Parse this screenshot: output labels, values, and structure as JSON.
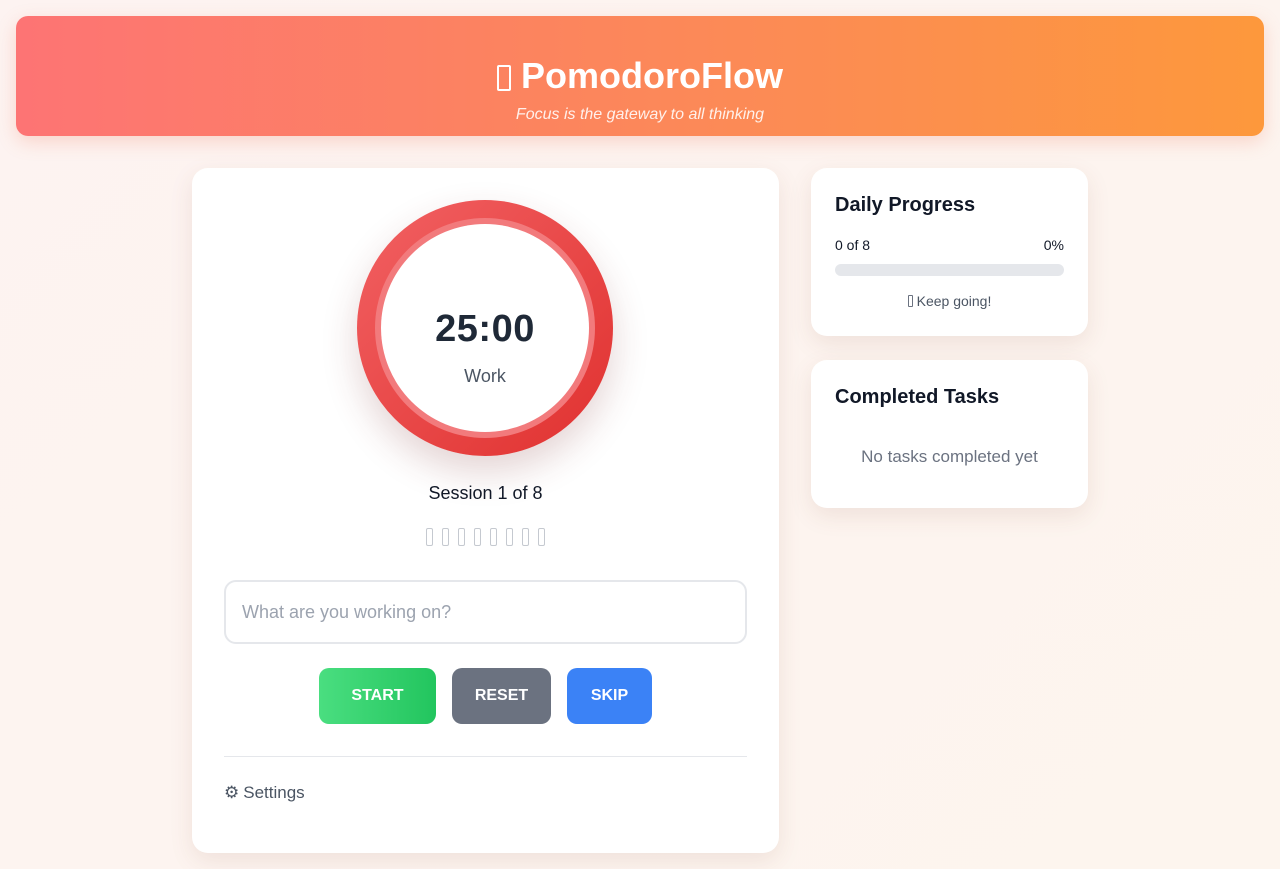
{
  "header": {
    "title": "PomodoroFlow",
    "subtitle": "Focus is the gateway to all thinking",
    "logo_icon": "tomato-icon"
  },
  "timer": {
    "time": "25:00",
    "mode": "Work",
    "session_text": "Session 1 of 8",
    "sessions_total": 8,
    "sessions_completed": 0,
    "ring_color": "#e53935"
  },
  "task": {
    "placeholder": "What are you working on?",
    "value": ""
  },
  "controls": {
    "start_label": "START",
    "reset_label": "RESET",
    "skip_label": "SKIP"
  },
  "settings": {
    "label": "Settings",
    "icon": "⚙"
  },
  "daily_progress": {
    "title": "Daily Progress",
    "count_text": "0 of 8",
    "percent_text": "0%",
    "percent": 0,
    "message": "Keep going!"
  },
  "completed_tasks": {
    "title": "Completed Tasks",
    "empty_text": "No tasks completed yet"
  }
}
